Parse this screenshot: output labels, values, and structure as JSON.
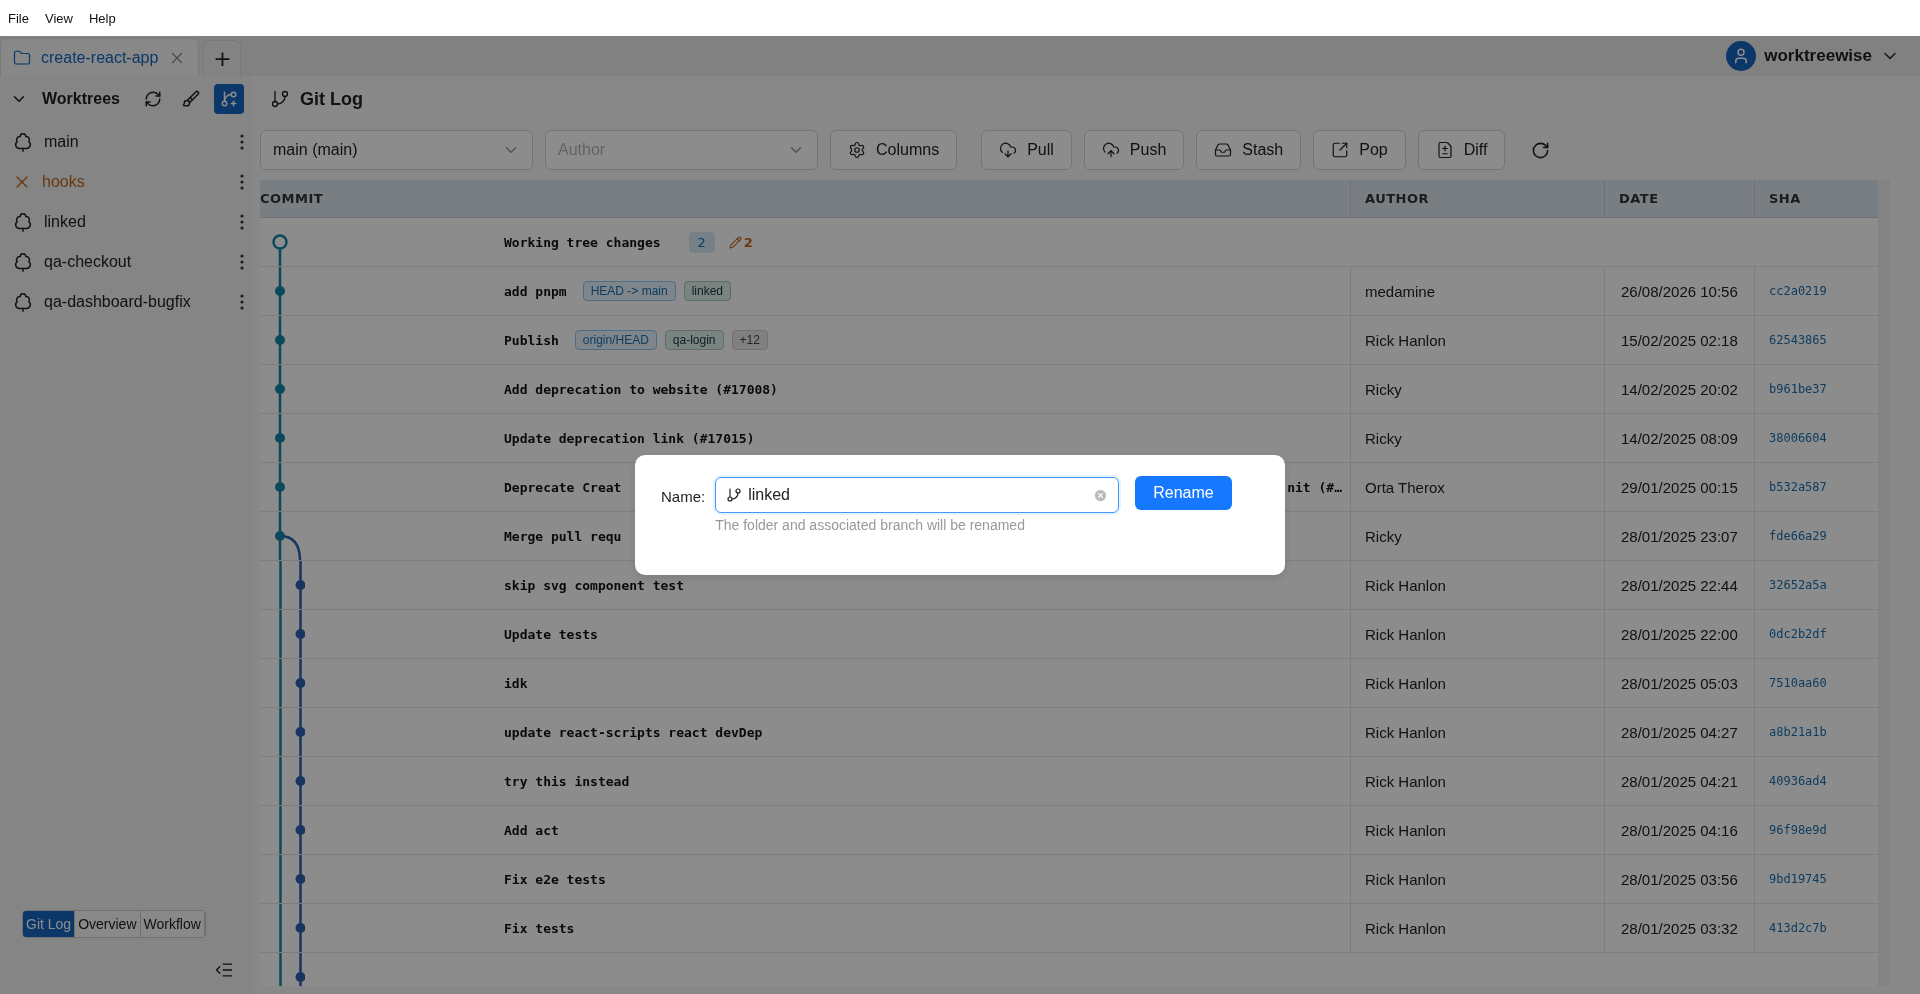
{
  "menu": [
    "File",
    "View",
    "Help"
  ],
  "tabs": [
    {
      "label": "create-react-app",
      "selected": true
    }
  ],
  "add_tab": "+",
  "user": {
    "name": "worktreewise"
  },
  "sidebar": {
    "title": "Worktrees",
    "expanded": true,
    "items": [
      {
        "label": "main",
        "missing": false
      },
      {
        "label": "hooks",
        "missing": true
      },
      {
        "label": "linked",
        "missing": false
      },
      {
        "label": "qa-checkout",
        "missing": false
      },
      {
        "label": "qa-dashboard-bugfix",
        "missing": false
      }
    ],
    "views": [
      {
        "label": "Git Log",
        "selected": true
      },
      {
        "label": "Overview",
        "selected": false
      },
      {
        "label": "Workflow",
        "selected": false
      }
    ]
  },
  "heading": "Git Log",
  "toolbar": {
    "branch": "main (main)",
    "author_placeholder": "Author",
    "buttons": [
      {
        "kind": "columns",
        "label": "Columns"
      },
      {
        "kind": "pull",
        "label": "Pull"
      },
      {
        "kind": "push",
        "label": "Push"
      },
      {
        "kind": "stash",
        "label": "Stash"
      },
      {
        "kind": "pop",
        "label": "Pop"
      },
      {
        "kind": "diff",
        "label": "Diff"
      }
    ]
  },
  "table": {
    "columns": [
      "COMMIT",
      "AUTHOR",
      "DATE",
      "SHA"
    ],
    "rows": [
      {
        "kind": "working",
        "message": "Working tree changes",
        "staged": "2",
        "edited": "2"
      },
      {
        "kind": "main",
        "message": "add pnpm",
        "tags": [
          {
            "label": "HEAD -> main",
            "kind": "head"
          },
          {
            "label": "linked",
            "kind": "local"
          }
        ],
        "author": "medamine",
        "date": "26/08/2026 10:56",
        "sha": "cc2a0219"
      },
      {
        "kind": "main",
        "message": "Publish",
        "tags": [
          {
            "label": "origin/HEAD",
            "kind": "remote"
          },
          {
            "label": "qa-login",
            "kind": "local"
          },
          {
            "label": "+12",
            "kind": "more"
          }
        ],
        "author": "Rick Hanlon",
        "date": "15/02/2025 02:18",
        "sha": "62543865"
      },
      {
        "kind": "main",
        "message": "Add deprecation to website (#17008)",
        "author": "Ricky",
        "date": "14/02/2025 20:02",
        "sha": "b961be37"
      },
      {
        "kind": "main",
        "message": "Update deprecation link (#17015)",
        "author": "Ricky",
        "date": "14/02/2025 08:09",
        "sha": "38006604"
      },
      {
        "kind": "main",
        "message": "Deprecate Creat",
        "tail": "nit (#…",
        "author": "Orta Therox",
        "date": "29/01/2025 00:15",
        "sha": "b532a587"
      },
      {
        "kind": "merge",
        "message": "Merge pull requ",
        "author": "Ricky",
        "date": "28/01/2025 23:07",
        "sha": "fde66a29"
      },
      {
        "kind": "branch",
        "message": "skip svg component test",
        "author": "Rick Hanlon",
        "date": "28/01/2025 22:44",
        "sha": "32652a5a"
      },
      {
        "kind": "branch",
        "message": "Update tests",
        "author": "Rick Hanlon",
        "date": "28/01/2025 22:00",
        "sha": "0dc2b2df"
      },
      {
        "kind": "branch",
        "message": "idk",
        "author": "Rick Hanlon",
        "date": "28/01/2025 05:03",
        "sha": "7510aa60"
      },
      {
        "kind": "branch",
        "message": "update react-scripts react devDep",
        "author": "Rick Hanlon",
        "date": "28/01/2025 04:27",
        "sha": "a8b21a1b"
      },
      {
        "kind": "branch",
        "message": "try this instead",
        "author": "Rick Hanlon",
        "date": "28/01/2025 04:21",
        "sha": "40936ad4"
      },
      {
        "kind": "branch",
        "message": "Add act",
        "author": "Rick Hanlon",
        "date": "28/01/2025 04:16",
        "sha": "96f98e9d"
      },
      {
        "kind": "branch",
        "message": "Fix e2e tests",
        "author": "Rick Hanlon",
        "date": "28/01/2025 03:56",
        "sha": "9bd19745"
      },
      {
        "kind": "branch",
        "message": "Fix tests",
        "author": "Rick Hanlon",
        "date": "28/01/2025 03:32",
        "sha": "413d2c7b"
      }
    ]
  },
  "dialog": {
    "label": "Name:",
    "value": "linked",
    "hint": "The folder and associated branch will be renamed",
    "button": "Rename"
  }
}
